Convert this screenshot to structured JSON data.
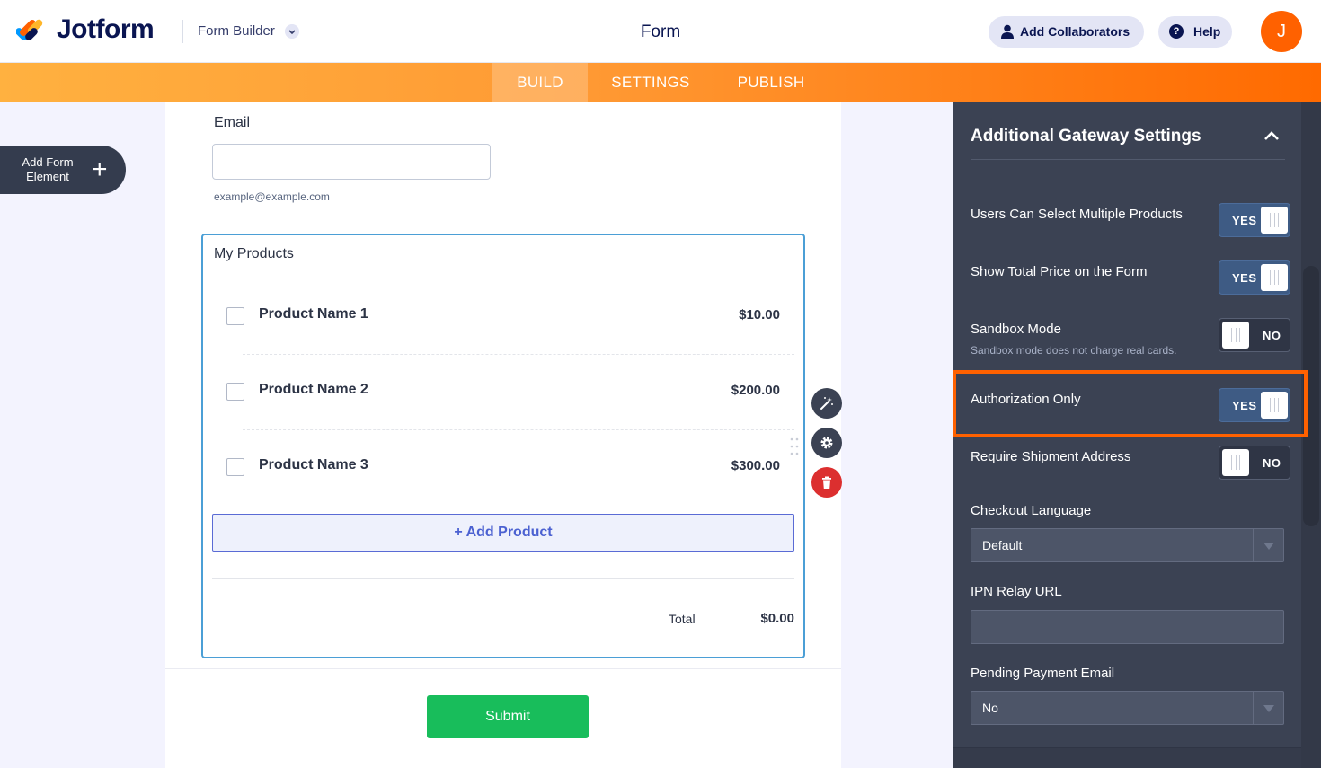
{
  "header": {
    "brand": "Jotform",
    "builder_label": "Form Builder",
    "form_title": "Form",
    "collaborators_label": "Add Collaborators",
    "help_label": "Help",
    "avatar_initial": "J"
  },
  "tabs": [
    {
      "label": "BUILD",
      "active": true
    },
    {
      "label": "SETTINGS",
      "active": false
    },
    {
      "label": "PUBLISH",
      "active": false
    }
  ],
  "left": {
    "add_element_label": "Add Form Element"
  },
  "form": {
    "email_label": "Email",
    "email_value": "",
    "email_help": "example@example.com",
    "products_title": "My Products",
    "products": [
      {
        "name": "Product Name 1",
        "price": "$10.00"
      },
      {
        "name": "Product Name 2",
        "price": "$200.00"
      },
      {
        "name": "Product Name 3",
        "price": "$300.00"
      }
    ],
    "add_product_label": "+ Add Product",
    "total_label": "Total",
    "total_value": "$0.00",
    "submit_label": "Submit"
  },
  "panel": {
    "title": "Additional Gateway Settings",
    "settings": [
      {
        "label": "Users Can Select Multiple Products",
        "toggle": "YES"
      },
      {
        "label": "Show Total Price on the Form",
        "toggle": "YES"
      },
      {
        "label": "Sandbox Mode",
        "sublabel": "Sandbox mode does not charge real cards.",
        "toggle": "NO"
      },
      {
        "label": "Authorization Only",
        "toggle": "YES"
      },
      {
        "label": "Require Shipment Address",
        "toggle": "NO"
      }
    ],
    "checkout_language_label": "Checkout Language",
    "checkout_language_value": "Default",
    "ipn_relay_label": "IPN Relay URL",
    "ipn_relay_value": "",
    "pending_email_label": "Pending Payment Email",
    "pending_email_value": "No"
  },
  "colors": {
    "accent": "#ff6100",
    "highlight": "#ff6100",
    "submit": "#18bd5b",
    "panel_bg": "#3b4253",
    "selection_border": "#4b9fd6"
  }
}
